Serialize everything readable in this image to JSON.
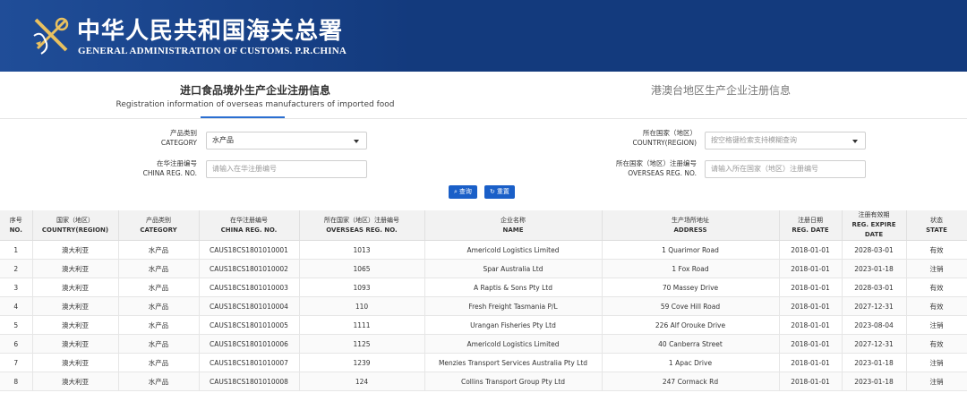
{
  "header": {
    "org_cn": "中华人民共和国海关总署",
    "org_en": "GENERAL ADMINISTRATION OF CUSTOMS. P.R.CHINA",
    "brand_color": "#133a7d",
    "emblem_icon": "customs-emblem-icon"
  },
  "tabs": [
    {
      "cn": "进口食品境外生产企业注册信息",
      "en": "Registration information of overseas manufacturers of imported food",
      "active": true
    },
    {
      "cn": "港澳台地区生产企业注册信息",
      "active": false
    }
  ],
  "form": {
    "category": {
      "label_cn": "产品类别",
      "label_en": "CATEGORY",
      "value": "水产品"
    },
    "country": {
      "label_cn": "所在国家（地区）",
      "label_en": "COUNTRY(REGION)",
      "placeholder": "按空格键检索支持模糊查询"
    },
    "china_reg": {
      "label_cn": "在华注册编号",
      "label_en": "CHINA REG. NO.",
      "placeholder": "请输入在华注册编号"
    },
    "overseas_reg": {
      "label_cn": "所在国家（地区）注册编号",
      "label_en": "OVERSEAS REG. NO.",
      "placeholder": "请输入所在国家（地区）注册编号"
    },
    "search_label": "查询",
    "reset_label": "重置",
    "accent_color": "#1a5fc8"
  },
  "table": {
    "columns": [
      {
        "cn": "序号",
        "en": "NO."
      },
      {
        "cn": "国家（地区）",
        "en": "COUNTRY(REGION)"
      },
      {
        "cn": "产品类别",
        "en": "CATEGORY"
      },
      {
        "cn": "在华注册编号",
        "en": "CHINA REG. NO."
      },
      {
        "cn": "所在国家（地区）注册编号",
        "en": "OVERSEAS REG. NO."
      },
      {
        "cn": "企业名称",
        "en": "NAME"
      },
      {
        "cn": "生产场所地址",
        "en": "ADDRESS"
      },
      {
        "cn": "注册日期",
        "en": "REG. DATE"
      },
      {
        "cn": "注册有效期",
        "en": "REG. EXPIRE DATE"
      },
      {
        "cn": "状态",
        "en": "STATE"
      }
    ],
    "rows": [
      [
        "1",
        "澳大利亚",
        "水产品",
        "CAUS18CS1801010001",
        "1013",
        "Americold Logistics Limited",
        "1 Quarimor Road",
        "2018-01-01",
        "2028-03-01",
        "有效"
      ],
      [
        "2",
        "澳大利亚",
        "水产品",
        "CAUS18CS1801010002",
        "1065",
        "Spar Australia Ltd",
        "1 Fox Road",
        "2018-01-01",
        "2023-01-18",
        "注销"
      ],
      [
        "3",
        "澳大利亚",
        "水产品",
        "CAUS18CS1801010003",
        "1093",
        "A Raptis & Sons Pty Ltd",
        "70 Massey Drive",
        "2018-01-01",
        "2028-03-01",
        "有效"
      ],
      [
        "4",
        "澳大利亚",
        "水产品",
        "CAUS18CS1801010004",
        "110",
        "Fresh Freight Tasmania P/L",
        "59 Cove Hill Road",
        "2018-01-01",
        "2027-12-31",
        "有效"
      ],
      [
        "5",
        "澳大利亚",
        "水产品",
        "CAUS18CS1801010005",
        "1111",
        "Urangan Fisheries Pty Ltd",
        "226 Alf Orouke Drive",
        "2018-01-01",
        "2023-08-04",
        "注销"
      ],
      [
        "6",
        "澳大利亚",
        "水产品",
        "CAUS18CS1801010006",
        "1125",
        "Americold Logistics Limited",
        "40 Canberra Street",
        "2018-01-01",
        "2027-12-31",
        "有效"
      ],
      [
        "7",
        "澳大利亚",
        "水产品",
        "CAUS18CS1801010007",
        "1239",
        "Menzies Transport Services Australia Pty Ltd",
        "1 Apac Drive",
        "2018-01-01",
        "2023-01-18",
        "注销"
      ],
      [
        "8",
        "澳大利亚",
        "水产品",
        "CAUS18CS1801010008",
        "124",
        "Collins Transport Group Pty Ltd",
        "247 Cormack Rd",
        "2018-01-01",
        "2023-01-18",
        "注销"
      ]
    ]
  }
}
